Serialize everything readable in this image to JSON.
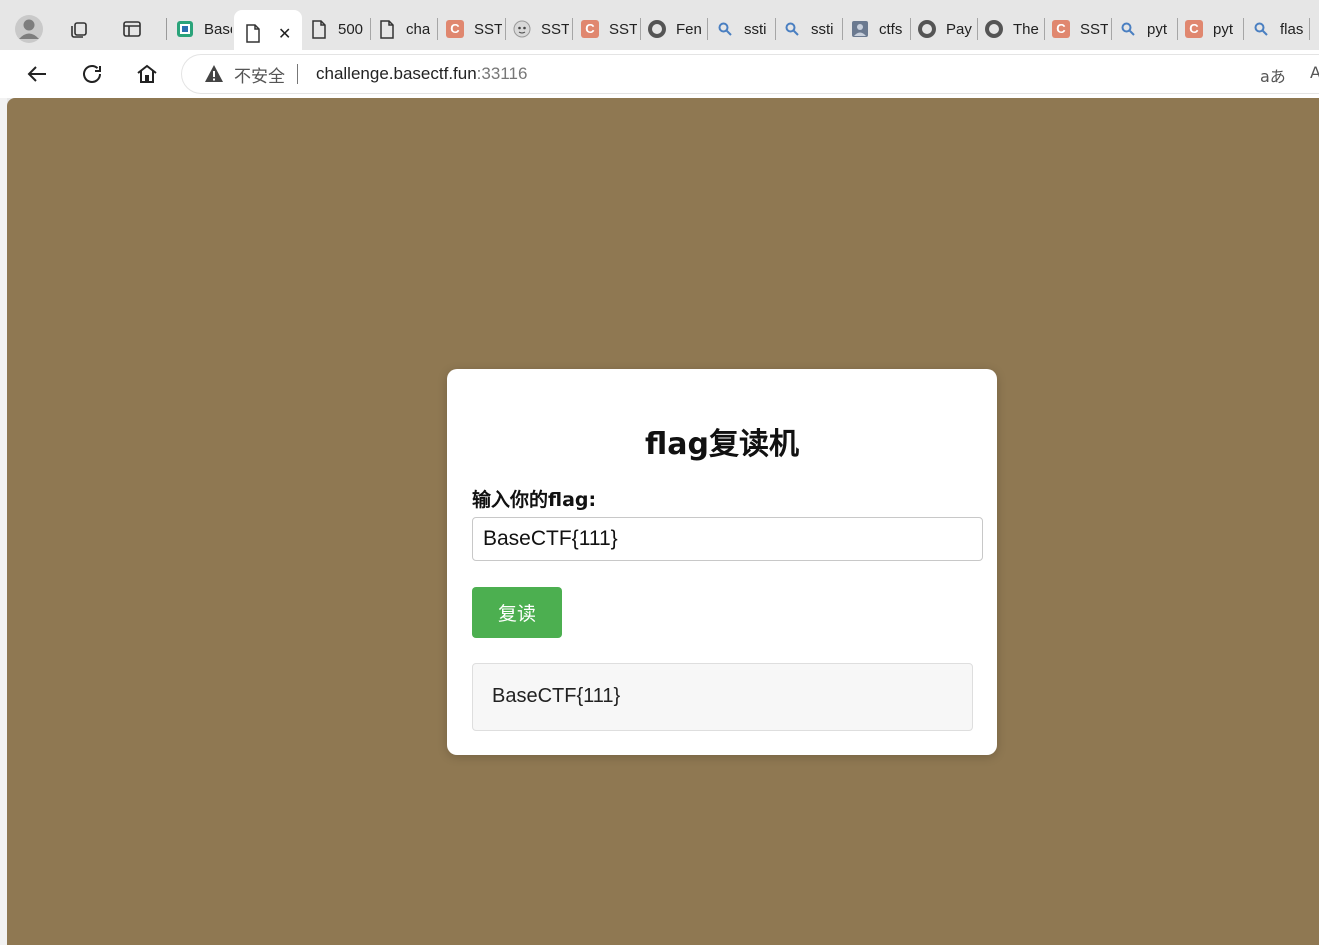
{
  "browser": {
    "tabs": [
      {
        "label": "Base",
        "favicon": "puzzle-logo-icon",
        "active": false
      },
      {
        "label": "",
        "favicon": "page-icon",
        "active": true,
        "close": "✕"
      },
      {
        "label": "500",
        "favicon": "page-icon",
        "active": false
      },
      {
        "label": "cha",
        "favicon": "page-icon",
        "active": false
      },
      {
        "label": "SST",
        "favicon": "c-logo-icon",
        "active": false
      },
      {
        "label": "SST",
        "favicon": "avatar-icon",
        "active": false
      },
      {
        "label": "SST",
        "favicon": "c-logo-icon",
        "active": false
      },
      {
        "label": "Fen",
        "favicon": "github-icon",
        "active": false
      },
      {
        "label": "ssti",
        "favicon": "search-icon",
        "active": false
      },
      {
        "label": "ssti",
        "favicon": "search-icon",
        "active": false
      },
      {
        "label": "ctfs",
        "favicon": "avatar-icon",
        "active": false
      },
      {
        "label": "Pay",
        "favicon": "github-icon",
        "active": false
      },
      {
        "label": "The",
        "favicon": "github-icon",
        "active": false
      },
      {
        "label": "SST",
        "favicon": "c-logo-icon",
        "active": false
      },
      {
        "label": "pyt",
        "favicon": "search-icon",
        "active": false
      },
      {
        "label": "pyt",
        "favicon": "c-logo-icon",
        "active": false
      },
      {
        "label": "flas",
        "favicon": "search-icon",
        "active": false
      }
    ],
    "c_logo_letter": "C",
    "security_label": "不安全",
    "url_host": "challenge.basectf.fun",
    "url_port": ":33116",
    "read_aloud_label": "aあ",
    "font_label": "A"
  },
  "page": {
    "background_color": "#8f7852",
    "title": "flag复读机",
    "input_label": "输入你的flag:",
    "input_value": "BaseCTF{111}",
    "button_label": "复读",
    "button_color": "#4caf50",
    "result_text": "BaseCTF{111}"
  }
}
